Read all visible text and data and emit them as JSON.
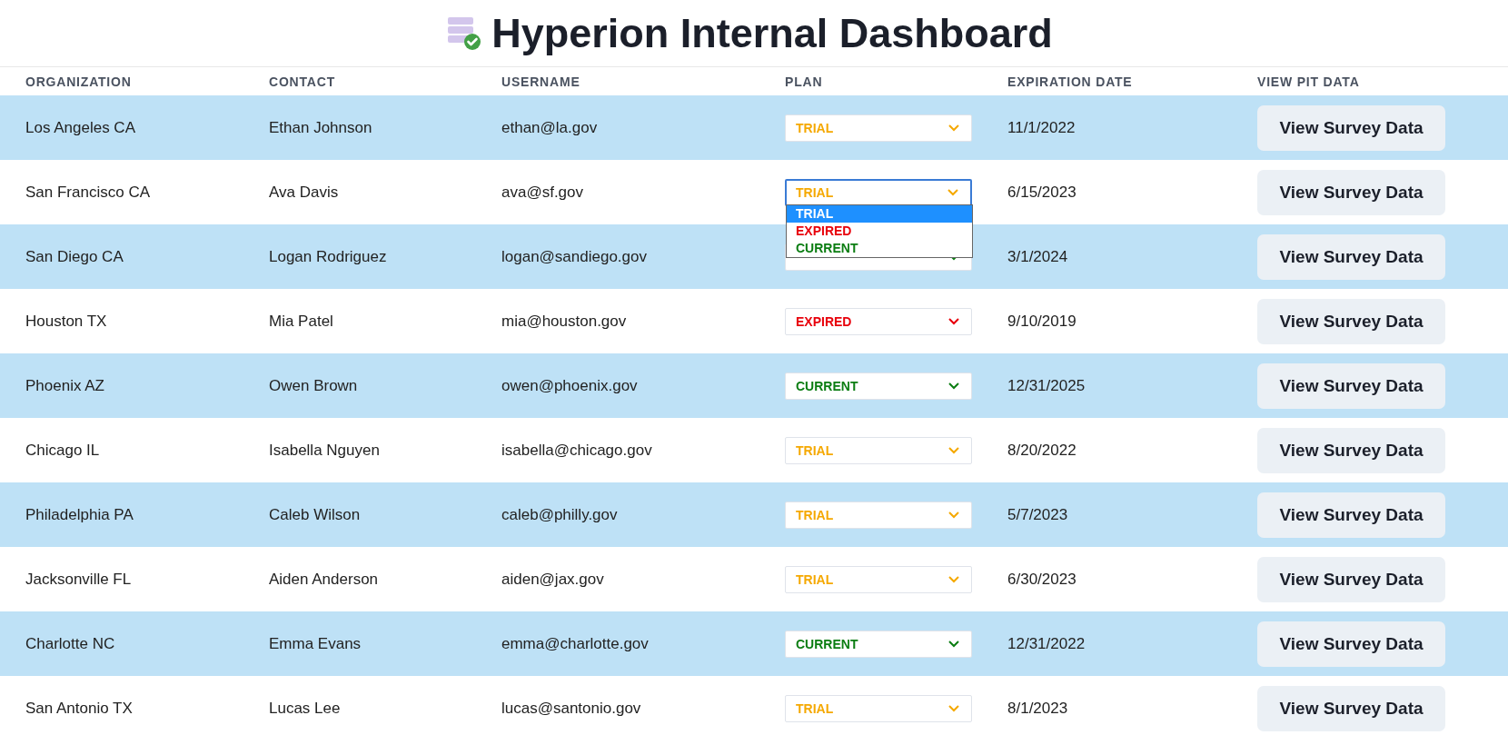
{
  "title": "Hyperion Internal Dashboard",
  "columns": [
    "ORGANIZATION",
    "CONTACT",
    "USERNAME",
    "PLAN",
    "EXPIRATION DATE",
    "VIEW PIT DATA"
  ],
  "rows": [
    {
      "organization": "Los Angeles CA",
      "contact": "Ethan Johnson",
      "username": "ethan@la.gov",
      "plan": {
        "value": "TRIAL",
        "kind": "trial",
        "expanded": false
      },
      "expiration": "11/1/2022",
      "action": "View Survey Data"
    },
    {
      "organization": "San Francisco CA",
      "contact": "Ava Davis",
      "username": "ava@sf.gov",
      "plan": {
        "value": "TRIAL",
        "kind": "trial",
        "expanded": true,
        "options": [
          {
            "label": "TRIAL",
            "selected": true
          },
          {
            "label": "EXPIRED",
            "kind": "expired",
            "selected": false
          },
          {
            "label": "CURRENT",
            "kind": "current",
            "selected": false
          }
        ]
      },
      "expiration": "6/15/2023",
      "action": "View Survey Data"
    },
    {
      "organization": "San Diego CA",
      "contact": "Logan Rodriguez",
      "username": "logan@sandiego.gov",
      "plan": {
        "kind": "current",
        "expanded": false
      },
      "expiration": "3/1/2024",
      "action": "View Survey Data"
    },
    {
      "organization": "Houston TX",
      "contact": "Mia Patel",
      "username": "mia@houston.gov",
      "plan": {
        "value": "EXPIRED",
        "kind": "expired",
        "expanded": false
      },
      "expiration": "9/10/2019",
      "action": "View Survey Data"
    },
    {
      "organization": "Phoenix AZ",
      "contact": "Owen Brown",
      "username": "owen@phoenix.gov",
      "plan": {
        "value": "CURRENT",
        "kind": "current",
        "expanded": false
      },
      "expiration": "12/31/2025",
      "action": "View Survey Data"
    },
    {
      "organization": "Chicago IL",
      "contact": "Isabella Nguyen",
      "username": "isabella@chicago.gov",
      "plan": {
        "value": "TRIAL",
        "kind": "trial",
        "expanded": false
      },
      "expiration": "8/20/2022",
      "action": "View Survey Data"
    },
    {
      "organization": "Philadelphia PA",
      "contact": "Caleb Wilson",
      "username": "caleb@philly.gov",
      "plan": {
        "value": "TRIAL",
        "kind": "trial",
        "expanded": false
      },
      "expiration": "5/7/2023",
      "action": "View Survey Data"
    },
    {
      "organization": "Jacksonville FL",
      "contact": "Aiden Anderson",
      "username": "aiden@jax.gov",
      "plan": {
        "value": "TRIAL",
        "kind": "trial",
        "expanded": false
      },
      "expiration": "6/30/2023",
      "action": "View Survey Data"
    },
    {
      "organization": "Charlotte NC",
      "contact": "Emma Evans",
      "username": "emma@charlotte.gov",
      "plan": {
        "value": "CURRENT",
        "kind": "current",
        "expanded": false
      },
      "expiration": "12/31/2022",
      "action": "View Survey Data"
    },
    {
      "organization": "San Antonio TX",
      "contact": "Lucas Lee",
      "username": "lucas@santonio.gov",
      "plan": {
        "value": "TRIAL",
        "kind": "trial",
        "expanded": false
      },
      "expiration": "8/1/2023",
      "action": "View Survey Data"
    }
  ]
}
